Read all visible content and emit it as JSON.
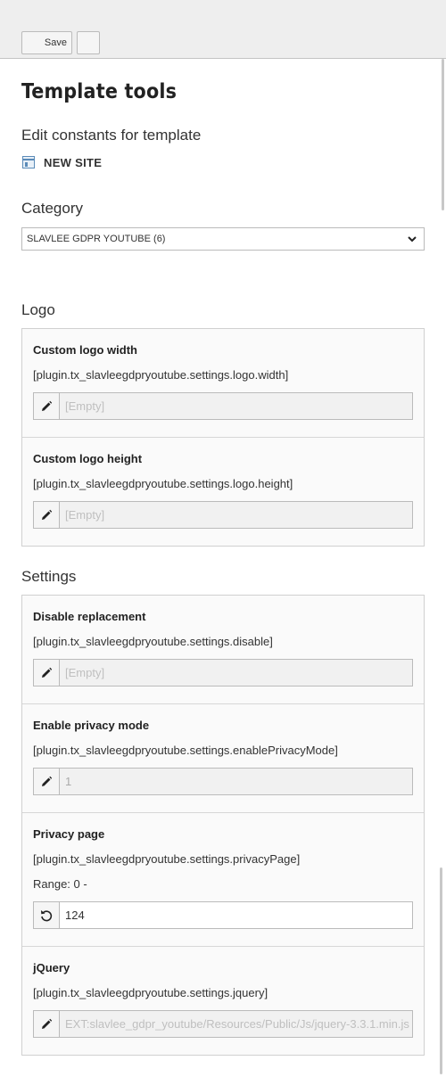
{
  "toolbar": {
    "save_label": "Save"
  },
  "page": {
    "title": "Template tools",
    "subtitle": "Edit constants for template",
    "site_name": "NEW SITE"
  },
  "category": {
    "label": "Category",
    "selected": "SLAVLEE GDPR YOUTUBE (6)"
  },
  "sections": {
    "logo": {
      "title": "Logo",
      "fields": [
        {
          "label": "Custom logo width",
          "key": "[plugin.tx_slavleegdpryoutube.settings.logo.width]",
          "value": "[Empty]"
        },
        {
          "label": "Custom logo height",
          "key": "[plugin.tx_slavleegdpryoutube.settings.logo.height]",
          "value": "[Empty]"
        }
      ]
    },
    "settings": {
      "title": "Settings",
      "fields": [
        {
          "label": "Disable replacement",
          "key": "[plugin.tx_slavleegdpryoutube.settings.disable]",
          "value": "[Empty]"
        },
        {
          "label": "Enable privacy mode",
          "key": "[plugin.tx_slavleegdpryoutube.settings.enablePrivacyMode]",
          "value": "1"
        },
        {
          "label": "Privacy page",
          "key": "[plugin.tx_slavleegdpryoutube.settings.privacyPage]",
          "range": "Range: 0 -",
          "value": "124"
        },
        {
          "label": "jQuery",
          "key": "[plugin.tx_slavleegdpryoutube.settings.jquery]",
          "value": "EXT:slavlee_gdpr_youtube/Resources/Public/Js/jquery-3.3.1.min.js"
        }
      ]
    }
  },
  "icons": {
    "site": "page-icon",
    "edit": "pencil-icon",
    "reset": "undo-icon",
    "dropdown": "chevron-down-icon"
  }
}
